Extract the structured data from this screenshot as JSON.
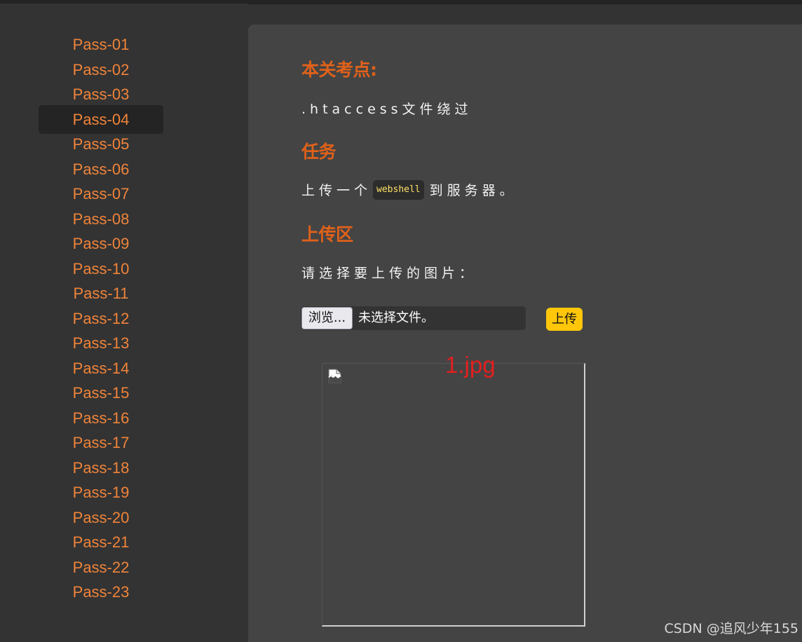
{
  "sidebar": {
    "items": [
      "Pass-01",
      "Pass-02",
      "Pass-03",
      "Pass-04",
      "Pass-05",
      "Pass-06",
      "Pass-07",
      "Pass-08",
      "Pass-09",
      "Pass-10",
      "Pass-11",
      "Pass-12",
      "Pass-13",
      "Pass-14",
      "Pass-15",
      "Pass-16",
      "Pass-17",
      "Pass-18",
      "Pass-19",
      "Pass-20",
      "Pass-21",
      "Pass-22",
      "Pass-23"
    ],
    "active_index": 3
  },
  "main": {
    "focus_heading": "本关考点:",
    "focus_text": ".htaccess文件绕过",
    "task_heading": "任务",
    "task_text_before": "上传一个",
    "task_code": "webshell",
    "task_text_after": "到服务器。",
    "upload_heading": "上传区",
    "upload_prompt": "请选择要上传的图片：",
    "browse_label": "浏览...",
    "file_status": "未选择文件。",
    "upload_button_label": "上传",
    "annotation": "1.jpg"
  },
  "watermark": "CSDN @追风少年155",
  "colors": {
    "accent_orange": "#e0611a",
    "nav_orange": "#f0843a",
    "upload_yellow": "#ffc60a",
    "annotation_red": "#e41f1f",
    "code_text": "#ffe066"
  },
  "icons": {
    "preview": "broken-image-icon"
  }
}
